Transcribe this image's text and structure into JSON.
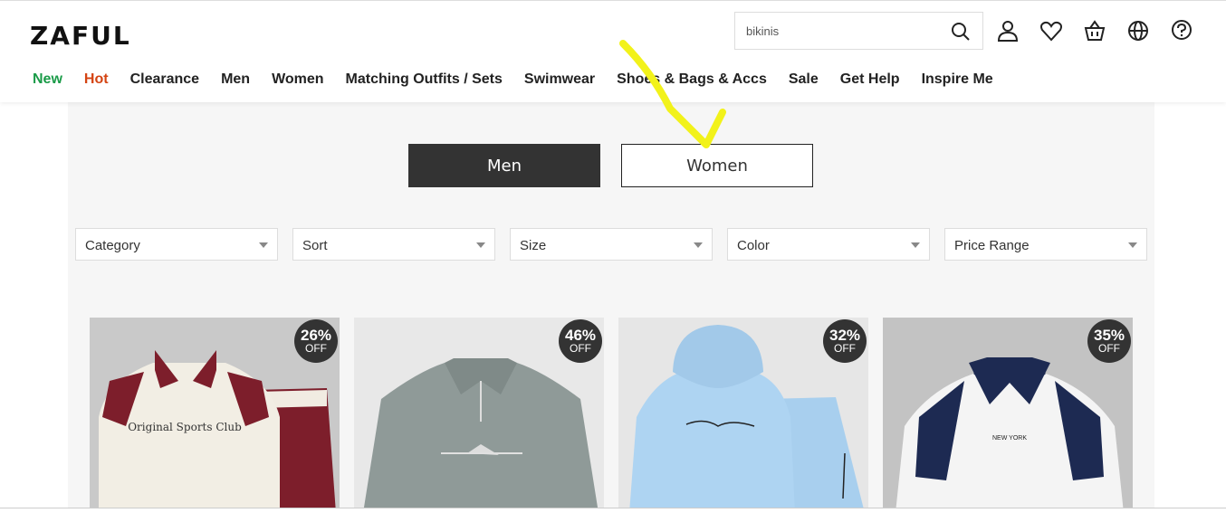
{
  "header": {
    "logo": "ZAFUL",
    "search": {
      "value": "bikinis",
      "icon": "search-icon"
    },
    "icons": [
      "user-icon",
      "heart-icon",
      "basket-icon",
      "globe-icon",
      "help-icon"
    ]
  },
  "nav": [
    "New",
    "Hot",
    "Clearance",
    "Men",
    "Women",
    "Matching Outfits / Sets",
    "Swimwear",
    "Shoes & Bags & Accs",
    "Sale",
    "Get Help",
    "Inspire Me"
  ],
  "gender_tabs": {
    "men": "Men",
    "women": "Women"
  },
  "filters": [
    "Category",
    "Sort",
    "Size",
    "Color",
    "Price Range"
  ],
  "products": [
    {
      "discount": "26%",
      "off": "OFF",
      "print_text": "Original Sports Club",
      "bg": "#c9c9c9"
    },
    {
      "discount": "46%",
      "off": "OFF",
      "bg": "#e8e8e8"
    },
    {
      "discount": "32%",
      "off": "OFF",
      "bg": "#e6e6e6"
    },
    {
      "discount": "35%",
      "off": "OFF",
      "print_text": "NEW YORK",
      "bg": "#c3c3c3"
    }
  ],
  "colors": {
    "new": "#1a9b48",
    "hot": "#d44413",
    "active_tab": "#333333",
    "annotation": "#f2f21a"
  }
}
